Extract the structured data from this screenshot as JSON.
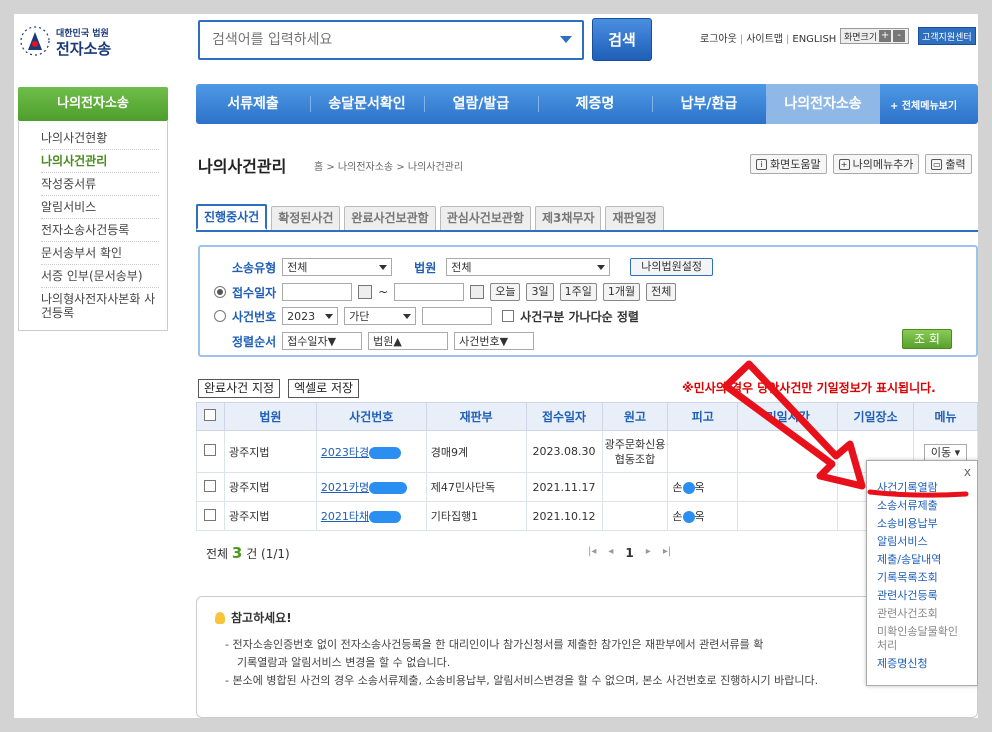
{
  "header": {
    "logo_sub": "대한민국 법원",
    "logo_main": "전자소송",
    "search_placeholder": "검색어를 입력하세요",
    "search_button": "검색",
    "top_links": [
      "로그아웃",
      "사이트맵",
      "ENGLISH"
    ],
    "font_size_label": "화면크기",
    "font_plus": "+",
    "font_minus": "-",
    "support": "고객지원센터"
  },
  "nav": {
    "items": [
      "서류제출",
      "송달문서확인",
      "열람/발급",
      "제증명",
      "납부/환급",
      "나의전자소송"
    ],
    "all_menu": "+ 전체메뉴보기"
  },
  "sidebar": {
    "title": "나의전자소송",
    "items": [
      "나의사건현황",
      "나의사건관리",
      "작성중서류",
      "알림서비스",
      "전자소송사건등록",
      "문서송부서 확인",
      "서증 인부(문서송부)",
      "나의형사전자사본화 사건등록"
    ]
  },
  "page": {
    "title": "나의사건관리",
    "breadcrumb": "홈 > 나의전자소송 > 나의사건관리",
    "util_buttons": [
      "화면도움말",
      "나의메뉴추가",
      "출력"
    ]
  },
  "tabs": [
    "진행중사건",
    "확정된사건",
    "완료사건보관함",
    "관심사건보관함",
    "제3채무자",
    "재판일정"
  ],
  "form": {
    "type_label": "소송유형",
    "type_value": "전체",
    "court_label": "법원",
    "court_value": "전체",
    "my_court_btn": "나의법원설정",
    "date_label": "접수일자",
    "tilde": "~",
    "date_buttons": [
      "오늘",
      "3일",
      "1주일",
      "1개월",
      "전체"
    ],
    "case_label": "사건번호",
    "year_value": "2023",
    "case_type_value": "가단",
    "sort_check_label": "사건구분 가나다순 정렬",
    "order_label": "정렬순서",
    "order_values": [
      "접수일자▼",
      "법원▲",
      "사건번호▼"
    ],
    "query_btn": "조 회"
  },
  "actions": {
    "complete_btn": "완료사건 지정",
    "excel_btn": "엑셀로 저장",
    "notice": "※민사의 경우 당안사건만 기일정보가 표시됩니다."
  },
  "table": {
    "headers": [
      "법원",
      "사건번호",
      "재판부",
      "접수일자",
      "원고",
      "피고",
      "기일시간",
      "기일장소",
      "메뉴"
    ],
    "rows": [
      {
        "court": "광주지법",
        "case_no": "2023타경",
        "division": "경매9계",
        "date": "2023.08.30",
        "plaintiff": "광주문화신용협동조합",
        "defendant_a": "",
        "defendant_b": "",
        "menu": "이동"
      },
      {
        "court": "광주지법",
        "case_no": "2021카명",
        "division": "제47민사단독",
        "date": "2021.11.17",
        "plaintiff": "",
        "defendant_a": "손",
        "defendant_b": "옥",
        "menu": ""
      },
      {
        "court": "광주지법",
        "case_no": "2021타채",
        "division": "기타집행1",
        "date": "2021.10.12",
        "plaintiff": "",
        "defendant_a": "손",
        "defendant_b": "옥",
        "menu": ""
      }
    ]
  },
  "summary": {
    "prefix": "전체",
    "count": "3",
    "suffix": "건 (1/1)",
    "page": "1"
  },
  "notice_box": {
    "title": "참고하세요!",
    "lines": [
      "- 전자소송인증번호 없이 전자소송사건등록을 한 대리인이나 참가신청서를 제출한 참가인은 재판부에서 관련서류를 확",
      "기록열람과 알림서비스 변경을 할 수 없습니다.",
      "- 본소에 병합된 사건의 경우 소송서류제출, 소송비용납부, 알림서비스변경을 할 수 없으며, 본소 사건번호로 진행하시기 바랍니다."
    ]
  },
  "popup": {
    "close": "x",
    "items": [
      "사건기록열람",
      "소송서류제출",
      "소송비용납부",
      "알림서비스",
      "제출/송달내역",
      "기록목록조회",
      "관련사건등록",
      "관련사건조회",
      "미확인송달물확인처리",
      "제증명신청"
    ]
  },
  "colors": {
    "primary": "#2f6fc0",
    "green": "#5aa02e",
    "annotation": "#e8101a"
  }
}
